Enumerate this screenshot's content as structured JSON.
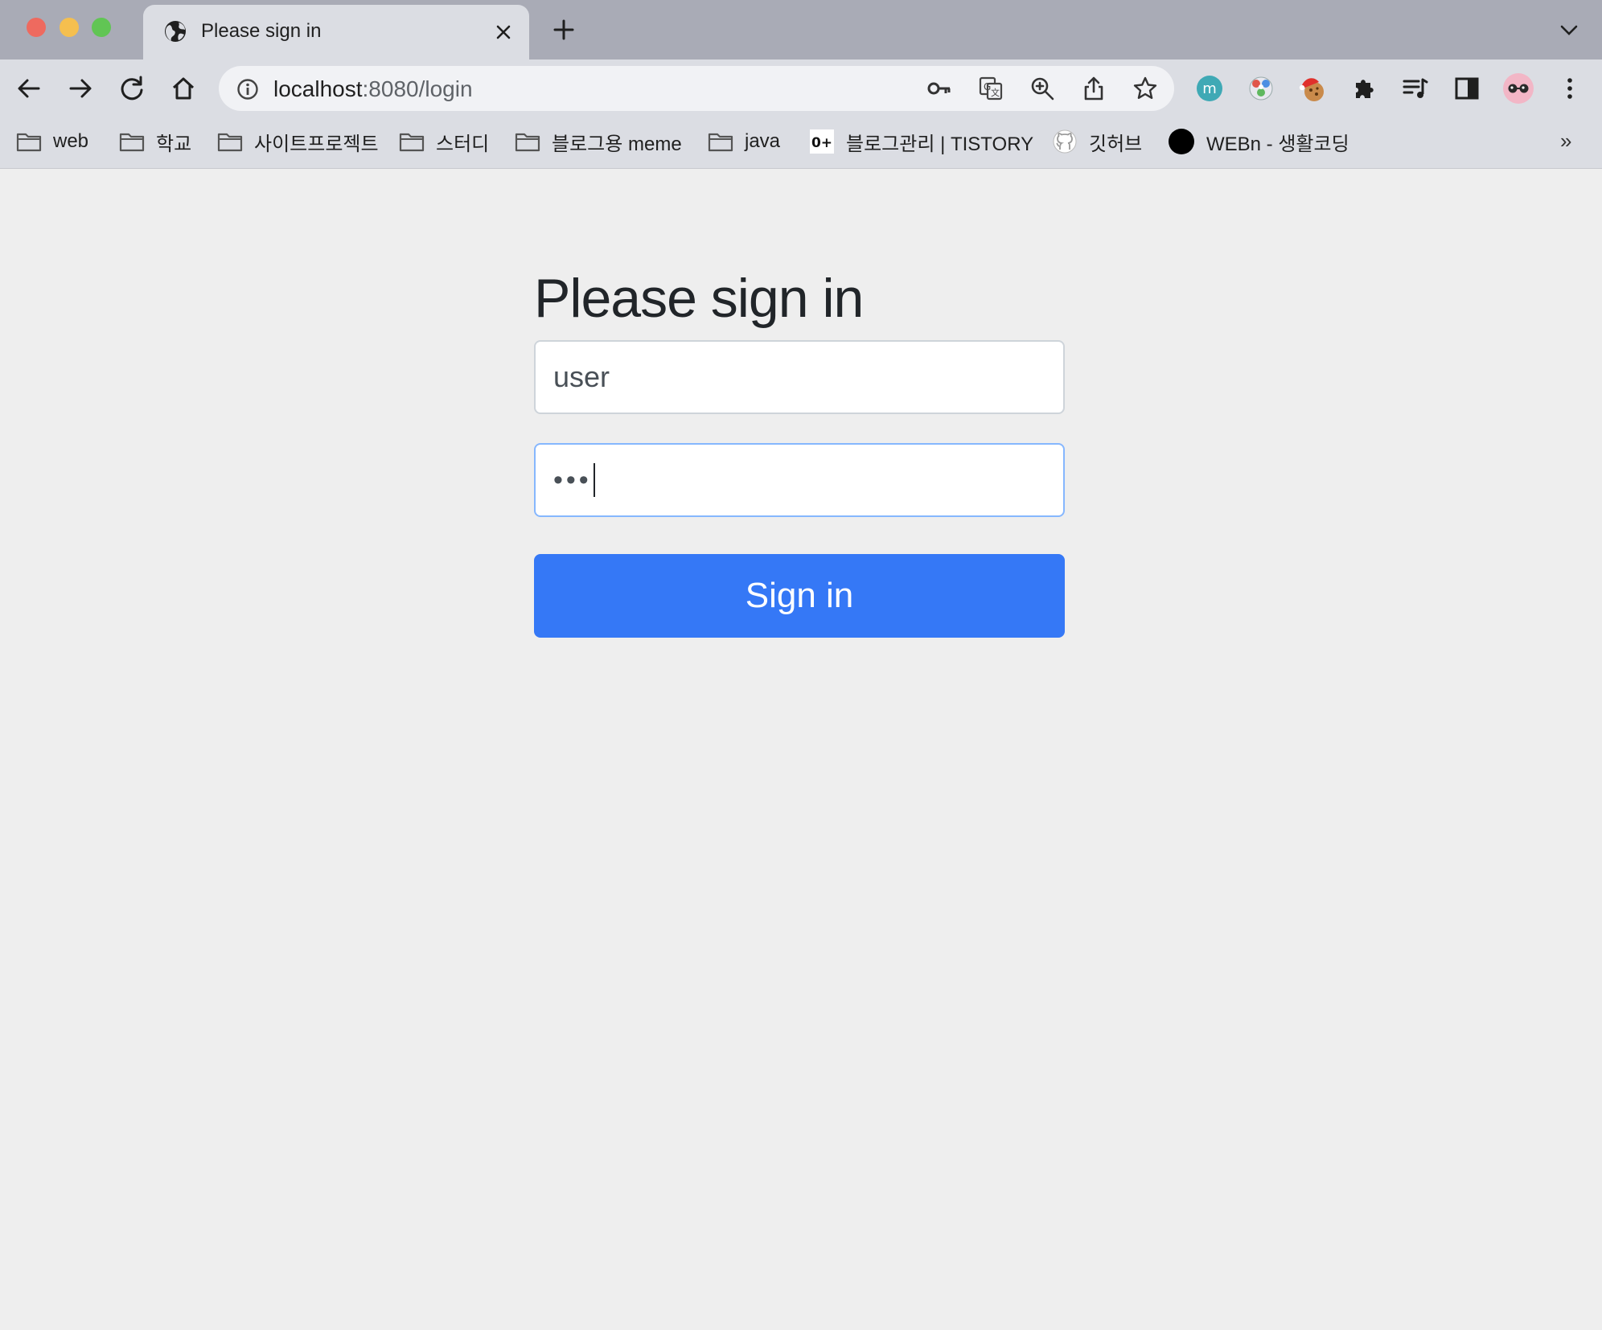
{
  "browser": {
    "tab": {
      "title": "Please sign in"
    },
    "address_bar": {
      "host": "localhost",
      "rest": ":8080/login"
    },
    "bookmarks": [
      {
        "label": "web",
        "icon": "folder-icon"
      },
      {
        "label": "학교",
        "icon": "folder-icon"
      },
      {
        "label": "사이트프로젝트",
        "icon": "folder-icon"
      },
      {
        "label": "스터디",
        "icon": "folder-icon"
      },
      {
        "label": "블로그용 meme",
        "icon": "folder-icon"
      },
      {
        "label": "java",
        "icon": "folder-icon"
      },
      {
        "label": "블로그관리 | TISTORY",
        "icon": "tistory-icon"
      },
      {
        "label": "깃허브",
        "icon": "github-icon"
      },
      {
        "label": "WEBn - 생활코딩",
        "icon": "black-circle-icon"
      }
    ],
    "bookmarks_overflow": "»",
    "extension_badge": "m"
  },
  "page": {
    "heading": "Please sign in",
    "username": {
      "value": "user"
    },
    "password": {
      "masked_value": "•••"
    },
    "submit_label": "Sign in"
  },
  "colors": {
    "primary_button": "#3578f6",
    "page_background": "#eeeeee",
    "chrome_background": "#dbdde3"
  }
}
